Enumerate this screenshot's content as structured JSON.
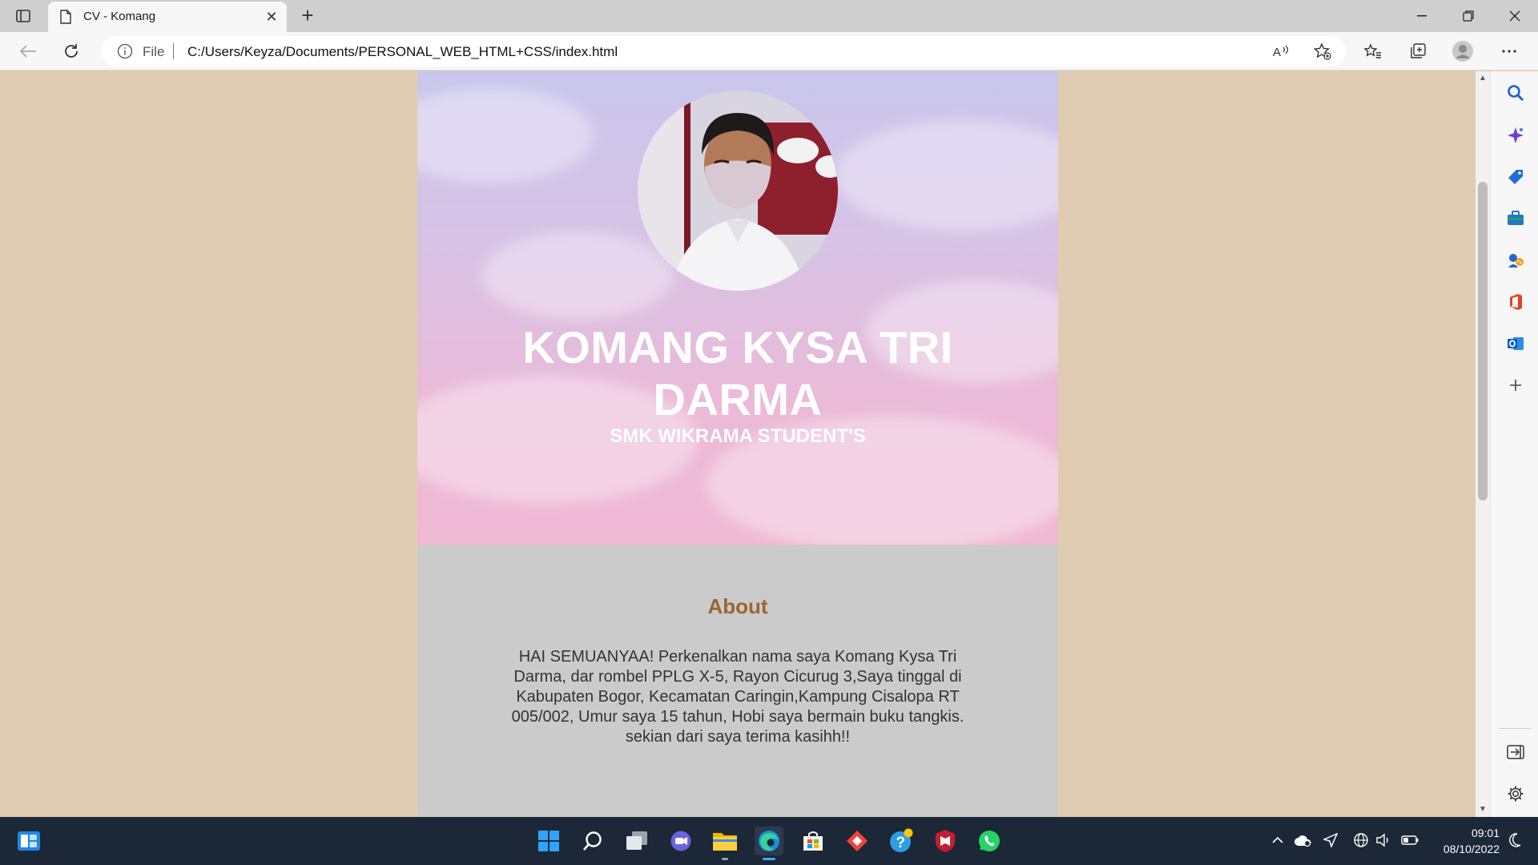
{
  "browser": {
    "tab": {
      "title": "CV - Komang"
    },
    "address": {
      "scheme_label": "File",
      "url": "C:/Users/Keyza/Documents/PERSONAL_WEB_HTML+CSS/index.html"
    }
  },
  "page": {
    "hero": {
      "name_line1": "KOMANG KYSA TRI",
      "name_line2": "DARMA",
      "subtitle": "SMK WIKRAMA STUDENT'S"
    },
    "about": {
      "title": "About",
      "text": "HAI SEMUANYAA! Perkenalkan nama saya Komang Kysa Tri Darma, dar rombel PPLG X-5, Rayon Cicurug 3,Saya tinggal di Kabupaten Bogor, Kecamatan Caringin,Kampung Cisalopa RT 005/002, Umur saya 15 tahun, Hobi saya bermain buku tangkis. sekian dari saya terima kasihh!!"
    }
  },
  "taskbar": {
    "clock": {
      "time": "09:01",
      "date": "08/10/2022"
    }
  },
  "colors": {
    "page_bg": "#e0ccb2",
    "about_bg": "#cbcbcb",
    "about_title": "#9b6630",
    "taskbar_bg": "#1c2837"
  }
}
